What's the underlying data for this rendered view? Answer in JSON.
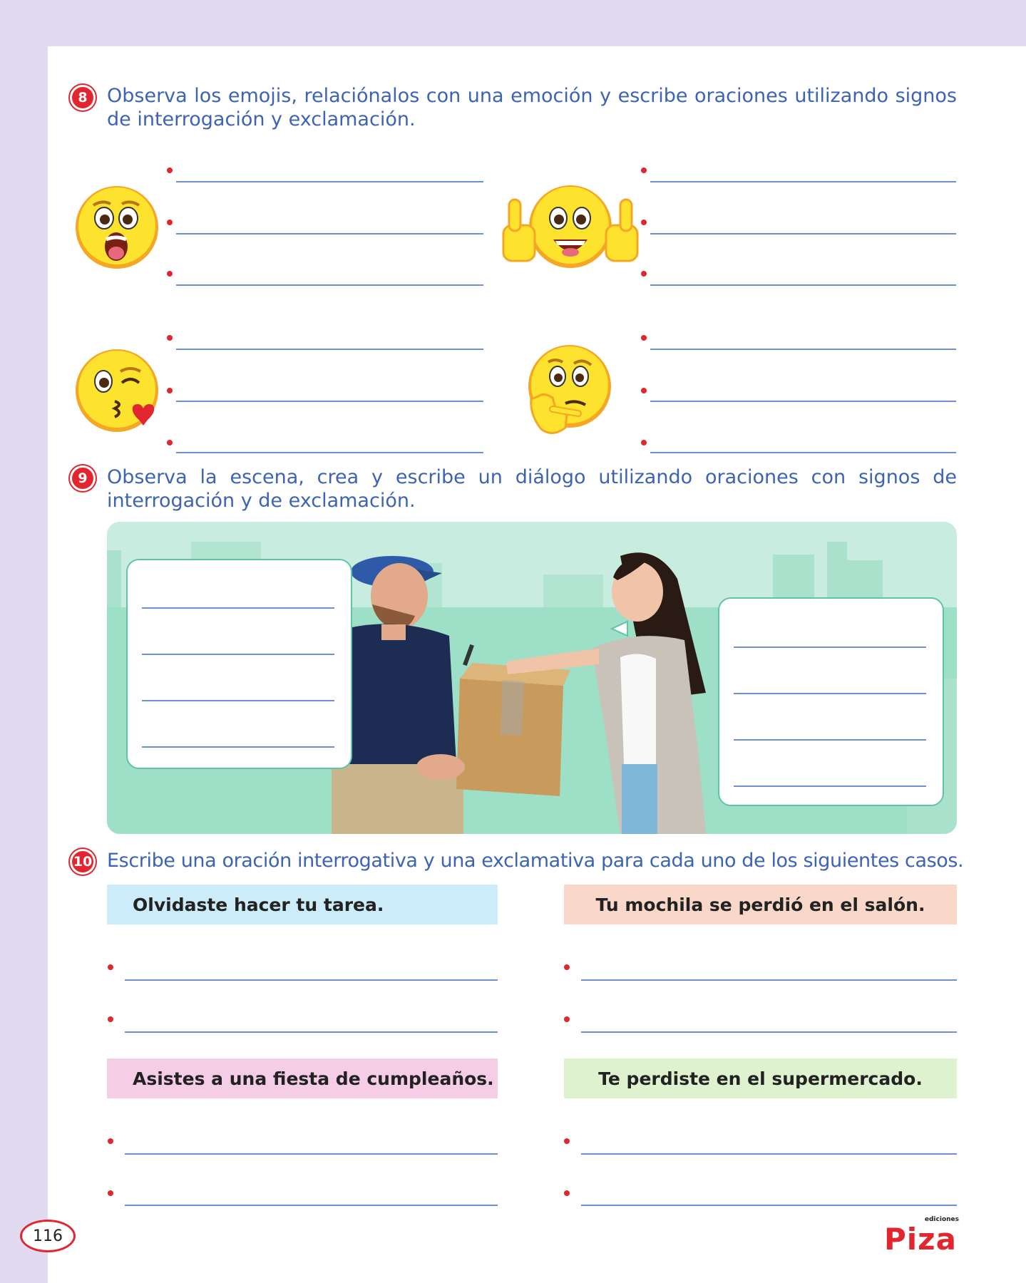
{
  "page_number": "116",
  "exercise8": {
    "number": "8",
    "instruction": "Observa los emojis, relaciónalos con una emoción y escribe oraciones utilizando signos de interrogación y exclamación.",
    "emojis": [
      "surprised-face-icon",
      "thumbs-up-happy-face-icon",
      "kiss-heart-face-icon",
      "thinking-face-icon"
    ]
  },
  "exercise9": {
    "number": "9",
    "instruction": "Observa la escena, crea y escribe un diálogo utilizando oraciones con signos de interrogación y de exclamación."
  },
  "exercise10": {
    "number": "10",
    "instruction": "Escribe una oración interrogativa y una exclamativa para cada uno de los siguientes casos.",
    "cases": [
      {
        "text": "Olvidaste hacer tu tarea.",
        "color": "#cbecf8"
      },
      {
        "text": "Tu mochila se perdió en el salón.",
        "color": "#f9d8c9"
      },
      {
        "text": "Asistes a una fiesta de cumpleaños.",
        "color": "#f6cde6"
      },
      {
        "text": "Te perdiste en el supermercado.",
        "color": "#dff2d0"
      }
    ]
  },
  "logo": {
    "brand": "Piza",
    "sub": "ediciones"
  },
  "colors": {
    "accent_red": "#e2262f",
    "text_blue": "#3d63b5",
    "line_blue": "#6f8ed3",
    "scene_mint": "#9edfc7"
  }
}
